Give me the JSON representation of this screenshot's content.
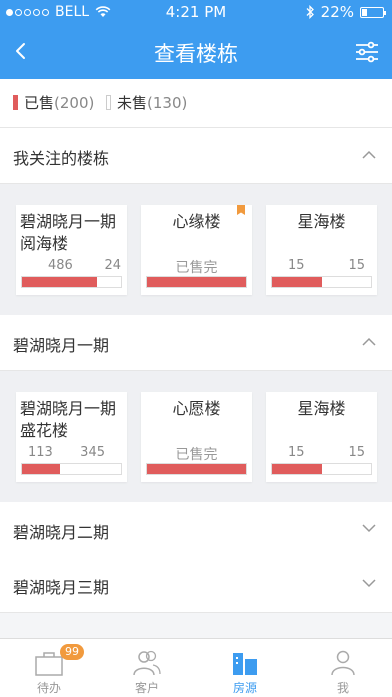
{
  "status": {
    "carrier": "BELL",
    "time": "4:21 PM",
    "battery": "22%"
  },
  "nav": {
    "title": "查看楼栋"
  },
  "legend": {
    "sold_label": "已售",
    "sold_count": "(200)",
    "sold_color": "#e05c5c",
    "unsold_label": "未售",
    "unsold_count": "(130)",
    "unsold_color": "#dddddd"
  },
  "sections": [
    {
      "title": "我关注的楼栋",
      "expanded": true
    },
    {
      "title": "碧湖晓月一期",
      "expanded": true
    },
    {
      "title": "碧湖晓月二期",
      "expanded": false
    },
    {
      "title": "碧湖晓月三期",
      "expanded": false
    }
  ],
  "favorites": [
    {
      "name": "碧湖晓月一期阅海楼",
      "name_line1": "碧湖晓月一期",
      "name_line2": "阅海楼",
      "sold": "486",
      "unsold": "24",
      "sold_fraction": 0.76,
      "flagged": false
    },
    {
      "name": "心缘楼",
      "sold_out_text": "已售完",
      "sold_fraction": 1.0,
      "flagged": true
    },
    {
      "name": "星海楼",
      "sold": "15",
      "unsold": "15",
      "sold_fraction": 0.5,
      "flagged": false
    }
  ],
  "phase1": [
    {
      "name_line1": "碧湖晓月一期",
      "name_line2": "盛花楼",
      "sold": "113",
      "unsold": "345",
      "sold_fraction": 0.38
    },
    {
      "name": "心愿楼",
      "sold_out_text": "已售完",
      "sold_fraction": 1.0
    },
    {
      "name": "星海楼",
      "sold": "15",
      "unsold": "15",
      "sold_fraction": 0.5
    }
  ],
  "tabs": [
    {
      "label": "待办",
      "badge": "99",
      "icon": "briefcase-icon"
    },
    {
      "label": "客户",
      "icon": "customers-icon"
    },
    {
      "label": "房源",
      "icon": "buildings-icon",
      "active": true
    },
    {
      "label": "我",
      "icon": "person-icon"
    }
  ],
  "colors": {
    "brand": "#3d9cf0",
    "sold": "#e05c5c",
    "badge": "#f19a3e",
    "flag": "#f19a3e"
  }
}
